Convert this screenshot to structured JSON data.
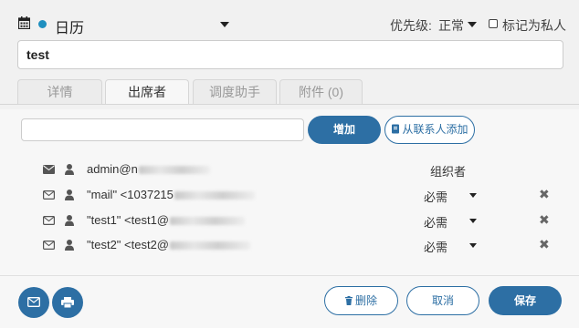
{
  "header": {
    "calendar_name": "日历",
    "calendar_color": "#1f8fbf",
    "priority_label": "优先级:",
    "priority_value": "正常",
    "private_label": "标记为私人",
    "private_checked": false
  },
  "event": {
    "title": "test"
  },
  "tabs": [
    {
      "label": "详情",
      "active": false
    },
    {
      "label": "出席者",
      "active": true
    },
    {
      "label": "调度助手",
      "active": false
    },
    {
      "label": "附件 (0)",
      "active": false
    }
  ],
  "attendees_toolbar": {
    "input_value": "",
    "add_label": "增加",
    "contacts_label": "从联系人添加"
  },
  "attendees": [
    {
      "email": "admin@n",
      "role": "组织者",
      "organizer": true
    },
    {
      "email": "\"mail\" <1037215",
      "role": "必需",
      "organizer": false
    },
    {
      "email": "\"test1\" <test1@",
      "role": "必需",
      "organizer": false
    },
    {
      "email": "\"test2\" <test2@",
      "role": "必需",
      "organizer": false
    }
  ],
  "footer": {
    "delete_label": "删除",
    "cancel_label": "取消",
    "save_label": "保存"
  },
  "colors": {
    "accent": "#2d6fa4"
  }
}
